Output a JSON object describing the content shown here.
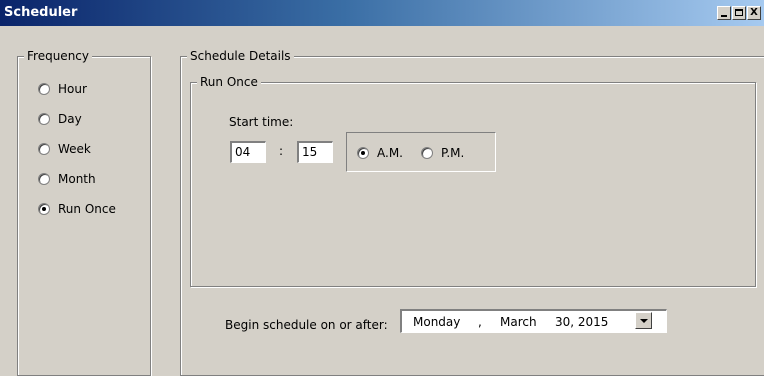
{
  "window": {
    "title": "Scheduler",
    "min_label": "",
    "max_label": "",
    "close_label": "X"
  },
  "frequency": {
    "legend": "Frequency",
    "options": [
      {
        "label": "Hour",
        "selected": false
      },
      {
        "label": "Day",
        "selected": false
      },
      {
        "label": "Week",
        "selected": false
      },
      {
        "label": "Month",
        "selected": false
      },
      {
        "label": "Run Once",
        "selected": true
      }
    ]
  },
  "details": {
    "legend": "Schedule Details",
    "run_once": {
      "legend": "Run Once",
      "start_time_label": "Start time:",
      "hour": "04",
      "separator": ":",
      "minute": "15",
      "am_label": "A.M.",
      "pm_label": "P.M.",
      "am_selected": true
    },
    "begin": {
      "label": "Begin schedule on or after:",
      "day": "Monday",
      "comma": ",",
      "month": "March",
      "date": "30, 2015"
    }
  }
}
